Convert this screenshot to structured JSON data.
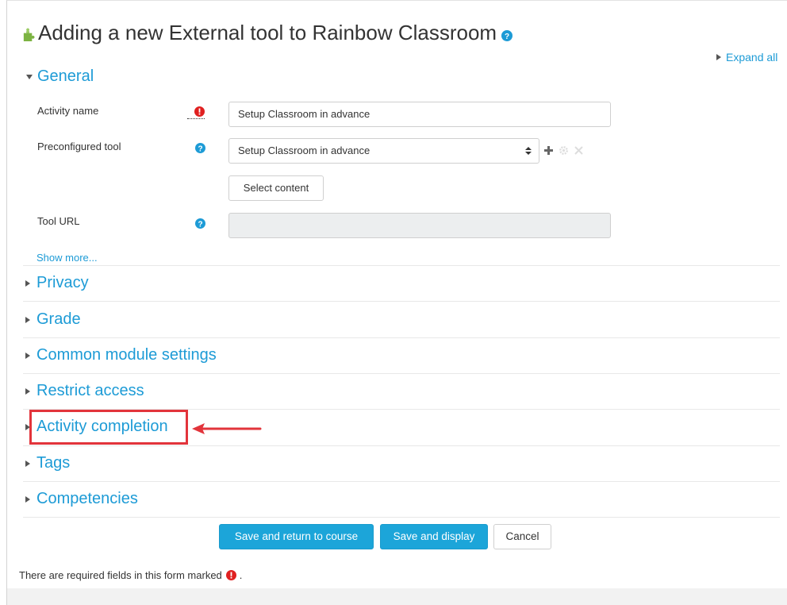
{
  "page": {
    "title": "Adding a new External tool to Rainbow Classroom",
    "expand_all": "Expand all"
  },
  "general": {
    "section_title": "General",
    "activity_name_label": "Activity name",
    "activity_name_value": "Setup Classroom in advance",
    "preconfigured_label": "Preconfigured tool",
    "preconfigured_value": "Setup Classroom in advance",
    "select_content_label": "Select content",
    "tool_url_label": "Tool URL",
    "tool_url_value": "",
    "show_more": "Show more..."
  },
  "sections": [
    {
      "title": "Privacy"
    },
    {
      "title": "Grade"
    },
    {
      "title": "Common module settings"
    },
    {
      "title": "Restrict access"
    },
    {
      "title": "Activity completion"
    },
    {
      "title": "Tags"
    },
    {
      "title": "Competencies"
    }
  ],
  "buttons": {
    "save_return": "Save and return to course",
    "save_display": "Save and display",
    "cancel": "Cancel"
  },
  "footer": {
    "required_note_before": "There are required fields in this form marked",
    "required_note_after": "."
  },
  "colors": {
    "link": "#1d9bd6",
    "primary": "#1ca5d9",
    "required": "#e02020",
    "highlight": "#e2343b"
  },
  "icons": {
    "title": "puzzle-icon",
    "help": "help-icon",
    "required": "required-icon",
    "add": "plus-icon",
    "edit": "gear-icon",
    "delete": "close-icon"
  }
}
